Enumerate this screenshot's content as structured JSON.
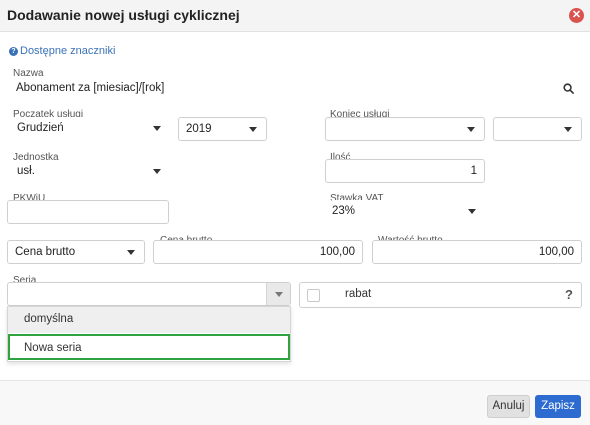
{
  "dialog": {
    "title": "Dodawanie nowej usługi cyklicznej",
    "markers_link": "Dostępne znaczniki"
  },
  "form": {
    "nazwa": {
      "label": "Nazwa",
      "value": "Abonament za [miesiac]/[rok]"
    },
    "poczatek": {
      "label": "Początek usługi",
      "month": "Grudzień",
      "year": "2019"
    },
    "koniec": {
      "label": "Koniec usługi",
      "month": "",
      "year": ""
    },
    "jednostka": {
      "label": "Jednostka",
      "value": "usł."
    },
    "ilosc": {
      "label": "Ilość",
      "value": "1"
    },
    "pkwiu": {
      "label": "PKWiU",
      "value": ""
    },
    "stawka_vat": {
      "label": "Stawka VAT",
      "value": "23%"
    },
    "price_type": {
      "value": "Cena brutto"
    },
    "cena_brutto": {
      "label": "Cena brutto",
      "value": "100,00"
    },
    "wartosc_brutto": {
      "label": "Wartość brutto",
      "value": "100,00"
    },
    "seria": {
      "label": "Seria",
      "value": "",
      "options": [
        "domyślna",
        "Nowa seria"
      ]
    },
    "rabat": {
      "label": "rabat",
      "help": "?"
    }
  },
  "footer": {
    "cancel_label": "Anuluj",
    "save_label": "Zapisz"
  },
  "colors": {
    "accent": "#2d6bd1",
    "close": "#d9534f",
    "highlight": "#2fa33d"
  }
}
